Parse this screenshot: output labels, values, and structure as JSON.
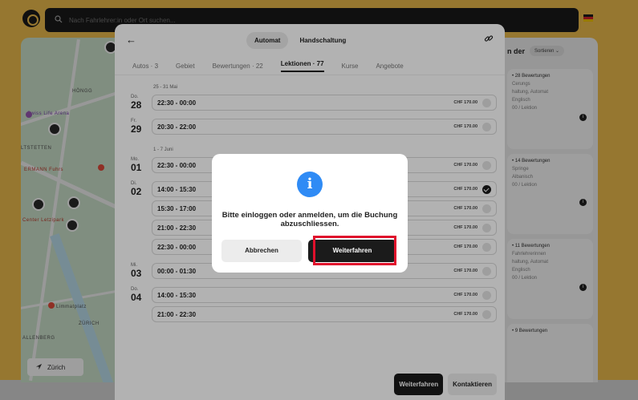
{
  "search": {
    "placeholder": "Nach Fahrlehrer:in oder Ort suchen..."
  },
  "map": {
    "labels": [
      "HÖNGG",
      "Swiss Life Arena",
      "LTSTETTEN",
      "ERMANN Fuhrs",
      "Center Letzipark",
      "Limmatplatz",
      "ZÜRICH",
      "ALLENBERG"
    ],
    "locate_button": "Zürich"
  },
  "right_panel": {
    "heading": "n der",
    "sort_label": "Sortieren",
    "cards": [
      {
        "reviews": "• 28 Bewertungen",
        "lines": [
          "Cerungs",
          "haltung, Automat",
          "Englisch",
          "00 / Lektion"
        ]
      },
      {
        "reviews": "• 14 Bewertungen",
        "lines": [
          "Springe",
          "Albanisch",
          "00 / Lektion"
        ]
      },
      {
        "reviews": "• 11 Bewertungen",
        "lines": [
          "Fahrlehrerinnen",
          "haltung, Automat",
          "Englisch",
          "00 / Lektion"
        ]
      },
      {
        "reviews": "• 9 Bewertungen",
        "lines": []
      }
    ]
  },
  "sheet": {
    "transmission": [
      "Automat",
      "Handschaltung"
    ],
    "tabs": [
      "Autos · 3",
      "Gebiet",
      "Bewertungen · 22",
      "Lektionen · 77",
      "Kurse",
      "Angebote"
    ],
    "weeks": [
      {
        "label": "25 - 31 Mai",
        "days": [
          {
            "name": "Do.",
            "date": "28",
            "slots": [
              {
                "time": "22:30 - 00:00",
                "price": "CHF 170.00",
                "checked": false
              }
            ]
          },
          {
            "name": "Fr.",
            "date": "29",
            "slots": [
              {
                "time": "20:30 - 22:00",
                "price": "CHF 170.00",
                "checked": false
              }
            ]
          }
        ]
      },
      {
        "label": "1 - 7 Juni",
        "days": [
          {
            "name": "Mo.",
            "date": "01",
            "slots": [
              {
                "time": "22:30 - 00:00",
                "price": "CHF 170.00",
                "checked": false
              }
            ]
          },
          {
            "name": "Di.",
            "date": "02",
            "slots": [
              {
                "time": "14:00 - 15:30",
                "price": "CHF 170.00",
                "checked": true
              },
              {
                "time": "15:30 - 17:00",
                "price": "CHF 170.00",
                "checked": false
              },
              {
                "time": "21:00 - 22:30",
                "price": "CHF 170.00",
                "checked": false
              },
              {
                "time": "22:30 - 00:00",
                "price": "CHF 170.00",
                "checked": false
              }
            ]
          },
          {
            "name": "Mi.",
            "date": "03",
            "slots": [
              {
                "time": "00:00 - 01:30",
                "price": "CHF 170.00",
                "checked": false
              }
            ]
          },
          {
            "name": "Do.",
            "date": "04",
            "slots": [
              {
                "time": "14:00 - 15:30",
                "price": "CHF 170.00",
                "checked": false
              },
              {
                "time": "21:00 - 22:30",
                "price": "CHF 170.00",
                "checked": false
              }
            ]
          }
        ]
      }
    ],
    "footer": {
      "continue": "Weiterfahren",
      "contact": "Kontaktieren"
    }
  },
  "dialog": {
    "message": "Bitte einloggen oder anmelden, um die Buchung abzuschliessen.",
    "cancel": "Abbrechen",
    "continue": "Weiterfahren"
  },
  "colors": {
    "brand_yellow": "#f2c14e",
    "info_blue": "#2f8bf5",
    "highlight_red": "#e0102c"
  }
}
